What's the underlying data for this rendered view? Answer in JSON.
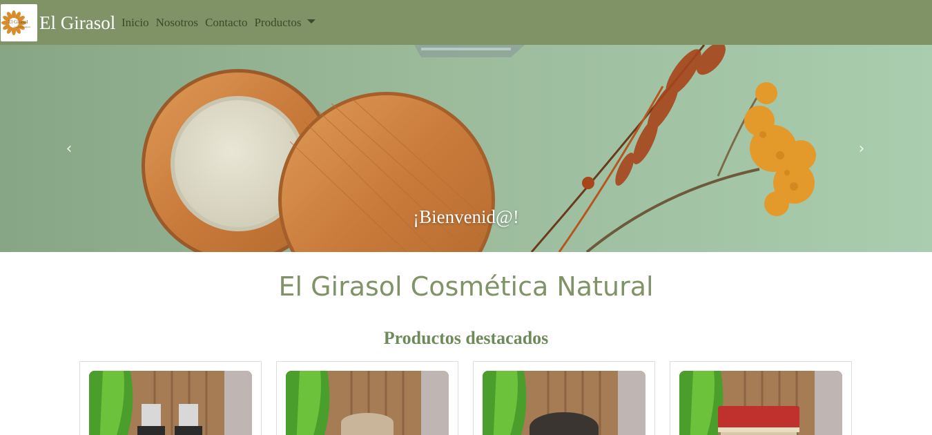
{
  "brand": {
    "name": "El Girasol",
    "logo_text": "El Girasol",
    "logo_subtext": "cosmética natural"
  },
  "nav": {
    "links": [
      "Inicio",
      "Nosotros",
      "Contacto",
      "Productos"
    ]
  },
  "hero": {
    "caption": "¡Bienvenid@!",
    "prev_icon": "chevron-left-icon",
    "next_icon": "chevron-right-icon"
  },
  "main": {
    "title": "El Girasol Cosmética Natural",
    "section_title": "Productos destacados"
  },
  "products": [
    {
      "image": "product-bottles-image"
    },
    {
      "image": "product-soap-bar-image"
    },
    {
      "image": "product-dark-soap-image"
    },
    {
      "image": "product-red-soap-image"
    }
  ],
  "colors": {
    "navbar": "#7f9367",
    "accent_title": "#7f9367",
    "nav_text": "#3b4a2c",
    "hero_bg": "#a4c4a6"
  }
}
